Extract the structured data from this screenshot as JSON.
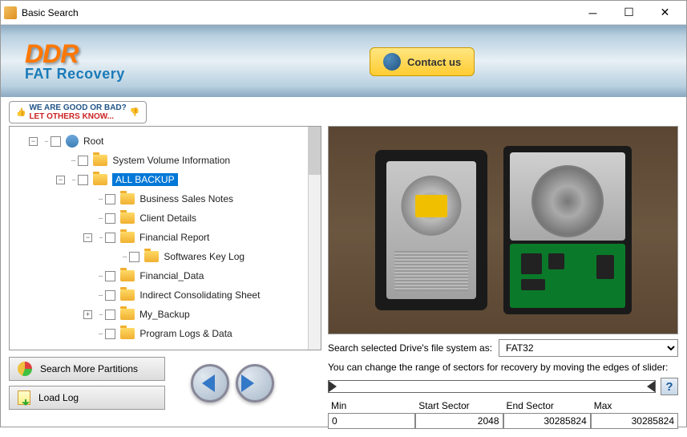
{
  "window": {
    "title": "Basic Search"
  },
  "header": {
    "brand": "DDR",
    "product": "FAT Recovery",
    "contact_label": "Contact us"
  },
  "feedback": {
    "line1": "WE ARE GOOD OR BAD?",
    "line2": "LET OTHERS KNOW..."
  },
  "tree": {
    "root": "Root",
    "items": [
      "System Volume Information",
      "ALL BACKUP",
      "Business Sales Notes",
      "Client Details",
      "Financial Report",
      "Softwares Key Log",
      "Financial_Data",
      "Indirect Consolidating Sheet",
      "My_Backup",
      "Program Logs & Data"
    ],
    "selected_index": 1
  },
  "buttons": {
    "search_more": "Search More Partitions",
    "load_log": "Load Log"
  },
  "filesystem": {
    "label": "Search selected Drive's file system as:",
    "value": "FAT32"
  },
  "slider": {
    "hint": "You can change the range of sectors for recovery by moving the edges of slider:",
    "headers": [
      "Min",
      "Start Sector",
      "End Sector",
      "Max"
    ],
    "values": [
      "0",
      "2048",
      "30285824",
      "30285824"
    ]
  }
}
